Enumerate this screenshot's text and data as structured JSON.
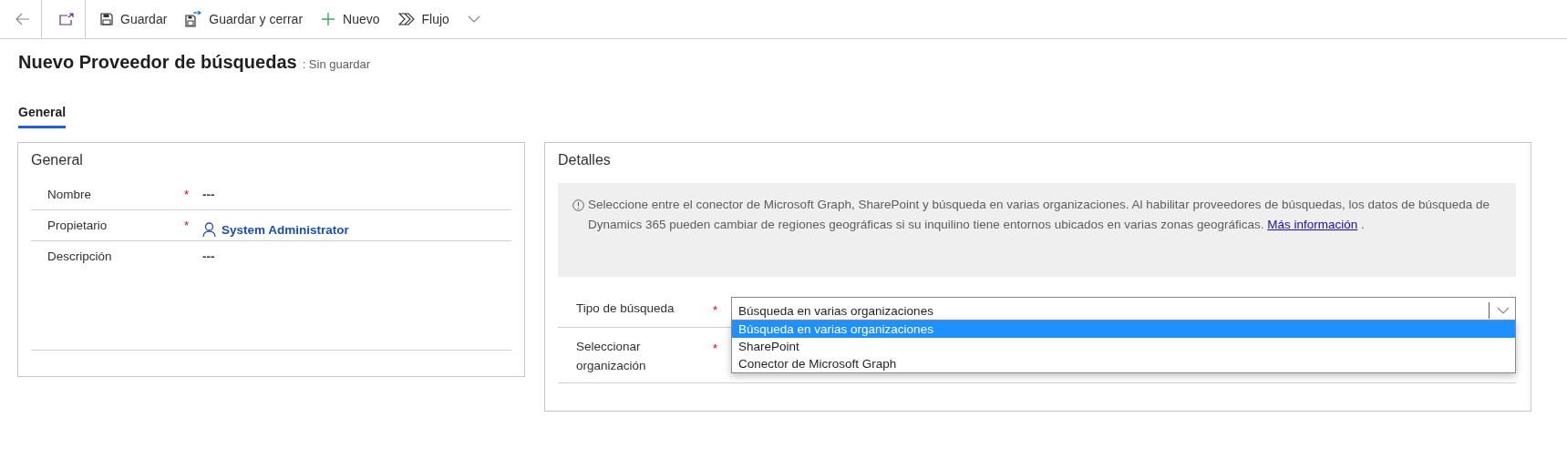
{
  "toolbar": {
    "buttons": [
      {
        "kind": "back"
      },
      {
        "kind": "popout"
      },
      {
        "kind": "save",
        "label": "Guardar"
      },
      {
        "kind": "save-close",
        "label": "Guardar y cerrar"
      },
      {
        "kind": "new",
        "label": "Nuevo"
      },
      {
        "kind": "flow",
        "label": "Flujo"
      },
      {
        "kind": "more"
      }
    ]
  },
  "header": {
    "title": "Nuevo Proveedor de búsquedas",
    "status": ": Sin guardar"
  },
  "tabs": [
    {
      "label": "General",
      "selected": true
    }
  ],
  "general_section": {
    "title": "General",
    "fields": [
      {
        "kind": "text",
        "label": "Nombre",
        "required_mark": "*",
        "value": "---"
      },
      {
        "kind": "lookup",
        "label": "Propietario",
        "required_mark": "*",
        "value": "System Administrator"
      },
      {
        "kind": "multiline",
        "label": "Descripción",
        "value": "---"
      }
    ]
  },
  "details_section": {
    "title": "Detalles",
    "notice": {
      "text": "Seleccione entre el conector de Microsoft Graph, SharePoint y búsqueda en varias organizaciones. Al habilitar proveedores de búsquedas, los datos de búsqueda de Dynamics 365 pueden cambiar de regiones geográficas si su inquilino tiene entornos ubicados en varias zonas geográficas.",
      "link": "Más información",
      "trailing": "."
    },
    "fields": [
      {
        "kind": "select",
        "label": "Tipo de búsqueda",
        "required_mark": "*",
        "value": "Búsqueda en varias organizaciones",
        "options": [
          {
            "label": "Búsqueda en varias organizaciones",
            "selected": true
          },
          {
            "label": "SharePoint",
            "selected": false
          },
          {
            "label": "Conector de Microsoft Graph",
            "selected": false
          }
        ]
      },
      {
        "kind": "empty",
        "label": "Seleccionar organización",
        "required_mark": "*"
      }
    ]
  }
}
